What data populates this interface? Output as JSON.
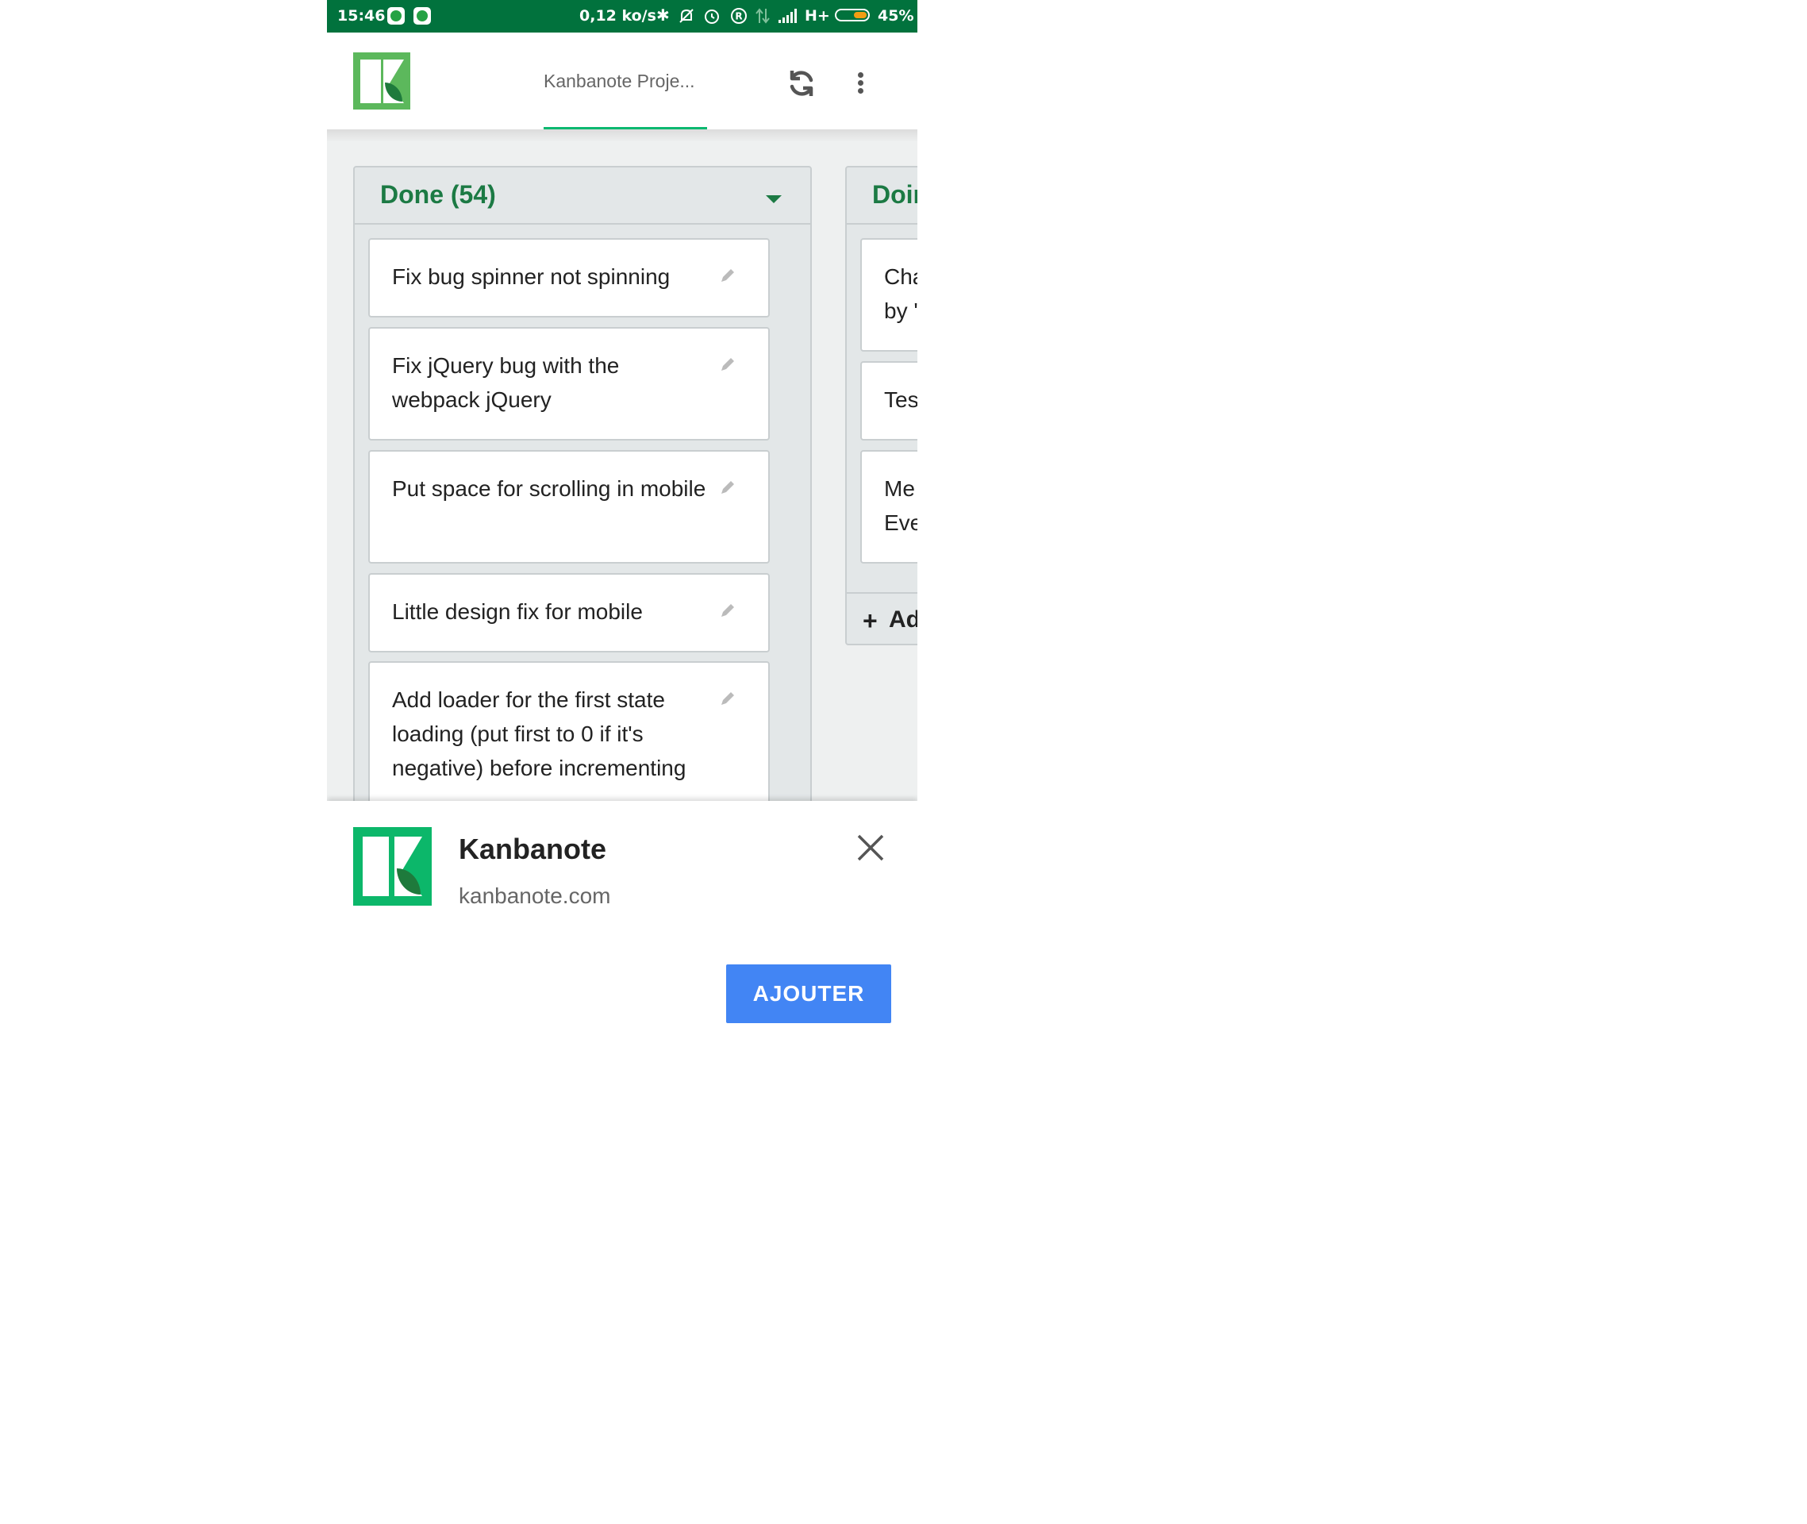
{
  "status_bar": {
    "time": "15:46",
    "speed": "0,12 ko/s",
    "network": "H+",
    "battery_percent": "45%",
    "battery_level": 0.45,
    "icons": [
      "whatsapp-icon",
      "whatsapp-icon",
      "bluetooth-icon",
      "bell-off-icon",
      "alarm-icon",
      "registered-icon",
      "data-transfer-icon",
      "signal-icon",
      "battery-icon"
    ]
  },
  "header": {
    "tab_title": "Kanbanote Proje...",
    "icons": [
      "kanbanote-logo",
      "sync-icon",
      "more-vert-icon"
    ]
  },
  "board": {
    "columns": [
      {
        "title": "Done (54)",
        "cards": [
          {
            "text": "Fix bug spinner not spinning"
          },
          {
            "text": "Fix jQuery bug with the webpack jQuery"
          },
          {
            "text": "Put space for scrolling in mobile"
          },
          {
            "text": "Little design fix for mobile"
          },
          {
            "text": "Add loader for the first state loading (put first to 0 if it's negative) before incrementing"
          }
        ]
      },
      {
        "title": "Doir",
        "cards": [
          {
            "text": "Cha\nby '"
          },
          {
            "text": "Tes"
          },
          {
            "text": "Me\nEve"
          }
        ],
        "add_label": "Ad"
      }
    ]
  },
  "banner": {
    "app_name": "Kanbanote",
    "app_url": "kanbanote.com",
    "add_button": "AJOUTER"
  },
  "colors": {
    "status_bar": "#01723d",
    "accent_green": "#1c7a44",
    "tab_indicator": "#0cb870",
    "logo_green": "#0cb76a",
    "button_blue": "#4285f4"
  }
}
